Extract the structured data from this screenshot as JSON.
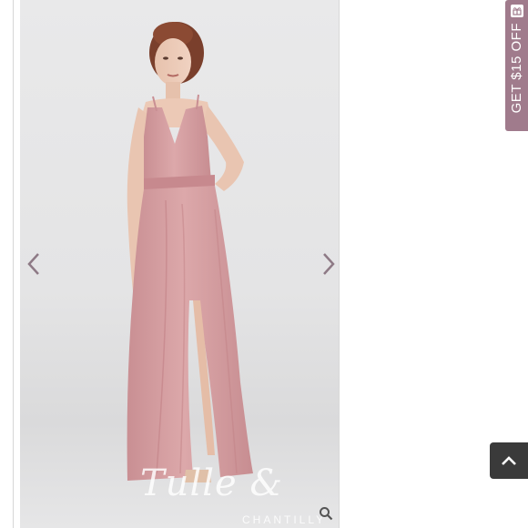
{
  "gallery": {
    "watermark_script": "Tulle &",
    "watermark_text": "CHANTILLY",
    "prev_icon": "chevron-left-icon",
    "next_icon": "chevron-right-icon",
    "zoom_icon": "magnifier-icon"
  },
  "promo": {
    "label": "GET $15 OFF",
    "icon": "gift-icon",
    "color": "#a07b8c"
  },
  "scroll_top": {
    "icon": "chevron-up-icon",
    "color": "#3a3a3a"
  },
  "colors": {
    "dress": "#d8a3a5",
    "arrow": "#8e7a86"
  }
}
